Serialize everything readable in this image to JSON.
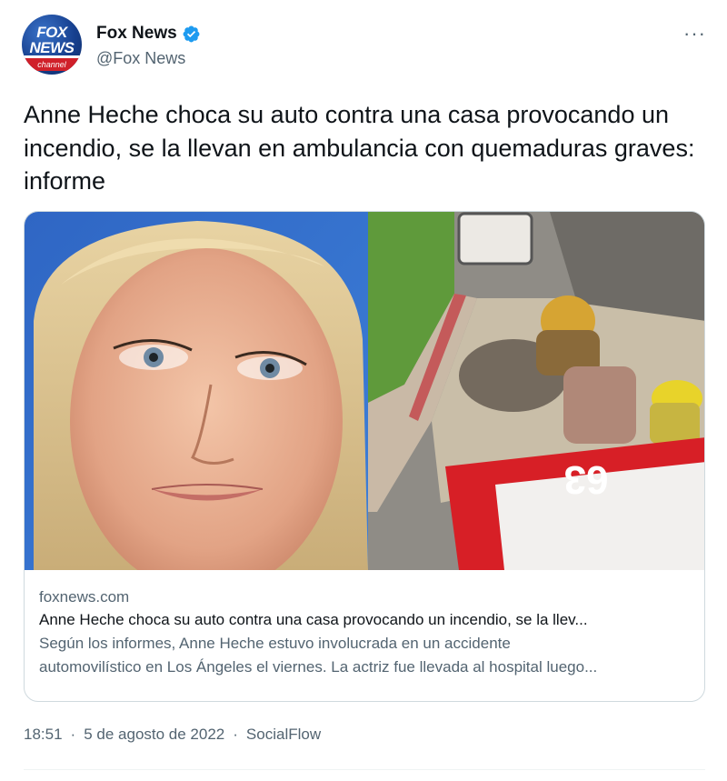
{
  "account": {
    "display_name": "Fox News",
    "handle": "@Fox News",
    "avatar_logo": {
      "line1": "FOX",
      "line2": "NEWS",
      "line3": "channel"
    },
    "verified": true
  },
  "more_label": "···",
  "tweet_text": "Anne Heche choca su auto contra una casa provocando un incendio, se la llevan en ambulancia con quemaduras graves: informe",
  "card": {
    "domain": "foxnews.com",
    "title": "Anne Heche choca su auto contra una casa provocando un incendio, se la llev...",
    "description_line1": "Según los informes, Anne Heche estuvo involucrada en un accidente",
    "description_line2": "automovilístico en Los Ángeles el viernes. La actriz fue llevada al hospital luego...",
    "truck_number": "63"
  },
  "footer": {
    "time": "18:51",
    "date": "5 de agosto de 2022",
    "source": "SocialFlow"
  },
  "colors": {
    "verified_blue": "#1d9bf0",
    "secondary_text": "#536471",
    "border": "#cfd9de"
  }
}
